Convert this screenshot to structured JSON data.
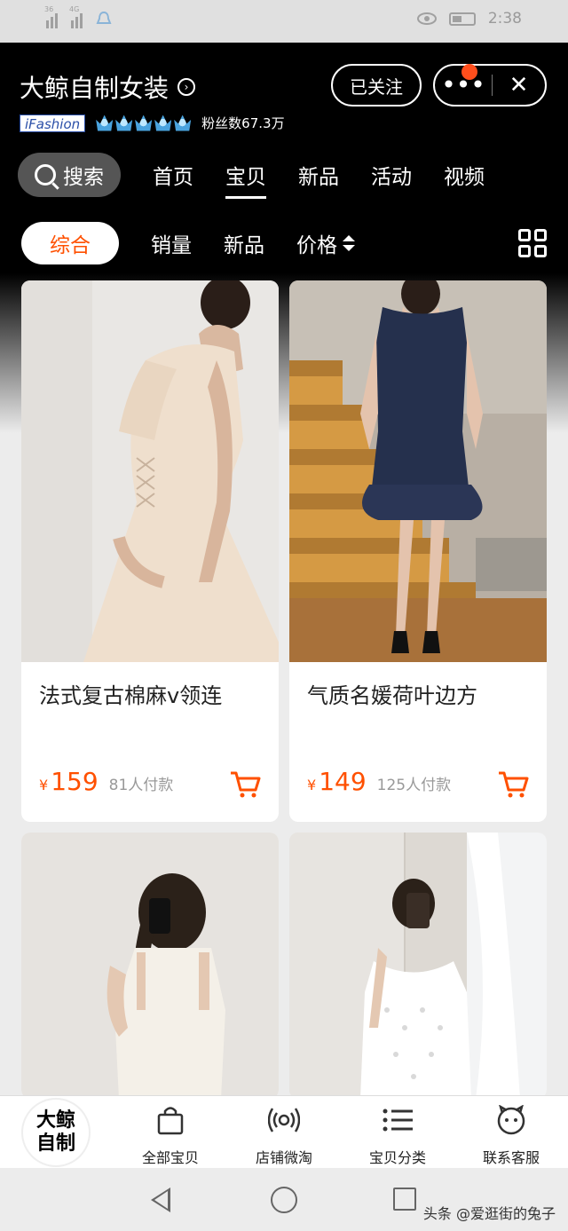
{
  "status_bar": {
    "signal1": "36",
    "signal2": "4G",
    "time": "2:38"
  },
  "header": {
    "shop_name": "大鲸自制女装",
    "shop_name_arrow": "›",
    "ifashion": "iFashion",
    "fans": "粉丝数67.3万",
    "follow_label": "已关注",
    "more_label": "•••",
    "close_label": "✕"
  },
  "nav": {
    "search_label": "搜索",
    "tabs": [
      {
        "label": "首页"
      },
      {
        "label": "宝贝"
      },
      {
        "label": "新品"
      },
      {
        "label": "活动"
      },
      {
        "label": "视频"
      }
    ]
  },
  "sort": {
    "items": [
      {
        "label": "综合"
      },
      {
        "label": "销量"
      },
      {
        "label": "新品"
      },
      {
        "label": "价格"
      }
    ]
  },
  "products": [
    {
      "name": "法式复古棉麻v领连",
      "currency": "¥",
      "price": "159",
      "sold": "81人付款"
    },
    {
      "name": "气质名媛荷叶边方",
      "currency": "¥",
      "price": "149",
      "sold": "125人付款"
    }
  ],
  "tabbar": {
    "logo_text": "大鲸\n自制",
    "items": [
      {
        "label": "全部宝贝",
        "icon": "shopping-bag-icon"
      },
      {
        "label": "店铺微淘",
        "icon": "broadcast-icon"
      },
      {
        "label": "宝贝分类",
        "icon": "list-icon"
      },
      {
        "label": "联系客服",
        "icon": "chat-icon"
      }
    ]
  },
  "watermark": "头条 @爱逛街的兔子",
  "colors": {
    "accent": "#ff5000",
    "header_bg": "#000000"
  }
}
